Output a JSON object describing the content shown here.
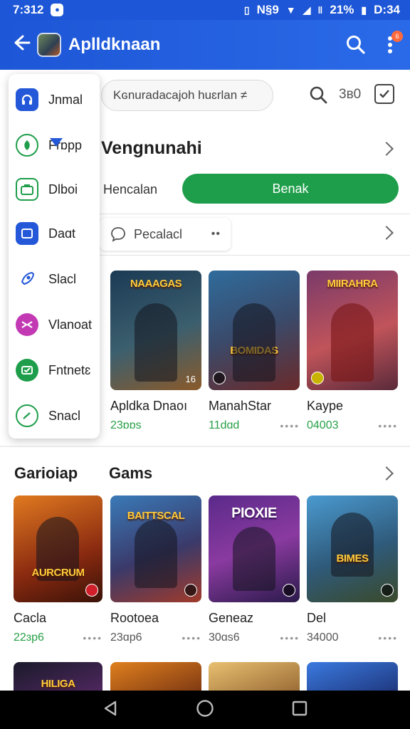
{
  "status_bar": {
    "time": "7:312",
    "right_text": "N§9",
    "battery_text": "21%",
    "clock_right": "D:34"
  },
  "app_bar": {
    "title": "Aplldknaan",
    "notification_count": "6",
    "accent_color": "#1d56d6"
  },
  "top_row": {
    "search_placeholder": "Kɢnuradacajoh huɛrlan ≠",
    "count": "3ʙ0"
  },
  "drawer": {
    "items": [
      {
        "label": "Jnmal",
        "icon": "headset-icon",
        "color": "#2458d8"
      },
      {
        "label": "Frɒpp",
        "icon": "leaf-icon",
        "color": "#1e9e4a"
      },
      {
        "label": "Dlboi",
        "icon": "briefcase-icon",
        "color": "#1e9e4a"
      },
      {
        "label": "Daɑt",
        "icon": "screen-icon",
        "color": "#2458d8"
      },
      {
        "label": "Slacl",
        "icon": "rocket-icon",
        "color": "#2458d8"
      },
      {
        "label": "Vlanoat",
        "icon": "controller-icon",
        "color": "#c239b3"
      },
      {
        "label": "Fntnetɛ",
        "icon": "ticket-icon",
        "color": "#1e9e4a"
      },
      {
        "label": "Snacl",
        "icon": "gauge-icon",
        "color": "#1e9e4a"
      }
    ]
  },
  "section1": {
    "title": "Vengnunahi",
    "segment_left": "Hencalan",
    "segment_right": "Benak",
    "chip_label": "Pecalacl",
    "cards": [
      {
        "name": "Apldka Dnaoı",
        "stat": "23ɒɒs",
        "banner": "NAAAGAS",
        "rating": "16",
        "bg": "#24435e"
      },
      {
        "name": "ManahStar",
        "stat": "11dɑd",
        "banner": "BOMIDAS",
        "bg": "#2c5478"
      },
      {
        "name": "Kaype",
        "stat": "04003",
        "banner": "MIIRAHRA",
        "bg": "#8b3a5a"
      }
    ]
  },
  "section2": {
    "label1": "Garioiap",
    "label2": "Gams",
    "cards": [
      {
        "name": "Cacla",
        "stat": "22ɜp6",
        "banner": "AURCRUM",
        "bg": "#b4431c"
      },
      {
        "name": "Rootoea",
        "stat": "23ɑp6",
        "banner": "BAITTSCAL",
        "bg": "#3a4d8a"
      },
      {
        "name": "Geneaz",
        "stat": "30ɑs6",
        "banner": "PIOXIE",
        "bg": "#5a2f7a"
      },
      {
        "name": "Del",
        "stat": "34000",
        "banner": "BIMES",
        "bg": "#2f6a8a"
      }
    ]
  },
  "section3": {
    "thumbs": [
      {
        "banner": "HILIGA",
        "bg": "#2a2a3a"
      },
      {
        "banner": "",
        "bg": "#c25a1e"
      },
      {
        "banner": "",
        "bg": "#d9a04a"
      },
      {
        "banner": "",
        "bg": "#2256a8"
      }
    ]
  }
}
